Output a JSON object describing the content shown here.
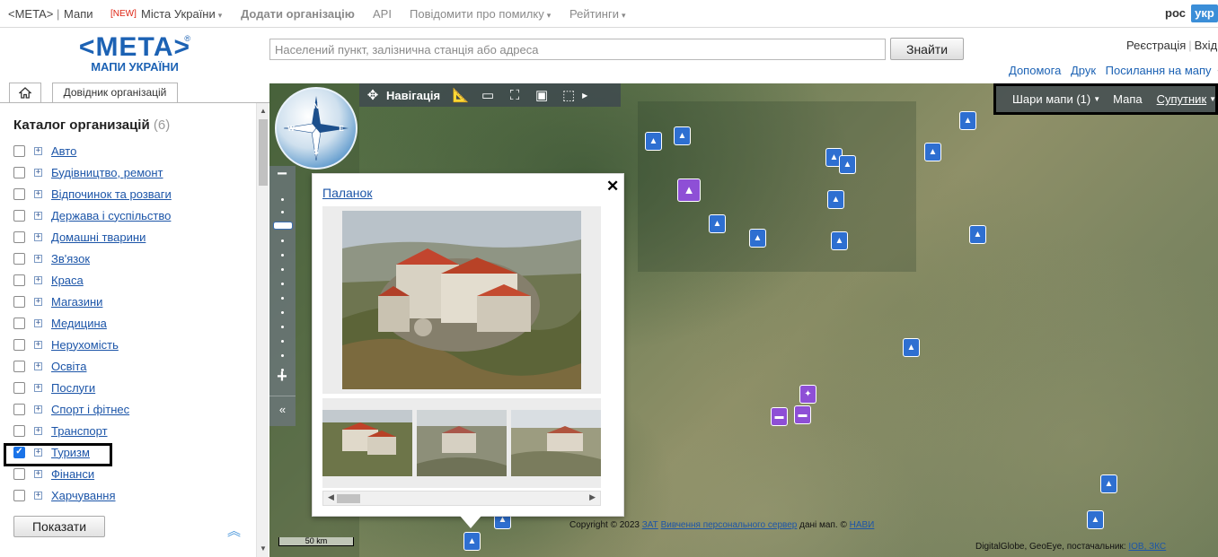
{
  "topnav": {
    "meta": "<META>",
    "sep": "|",
    "maps": "Мапи",
    "new_badge": "[NEW]",
    "cities": "Міста України",
    "add_org": "Додати організацію",
    "api": "API",
    "report_error": "Повідомити про помилку",
    "ratings": "Рейтинги",
    "lang_ros": "рос",
    "lang_ukr": "укр"
  },
  "header": {
    "logo_main": "<МЕТА>",
    "logo_reg": "®",
    "logo_sub": "МАПИ УКРАЇНИ",
    "search_placeholder": "Населений пункт, залізнична станція або адреса",
    "search_value": "",
    "find_button": "Знайти",
    "register": "Реєстрація",
    "login": "Вхід",
    "help": "Допомога",
    "print": "Друк",
    "map_link": "Посилання на мапу"
  },
  "tabs": {
    "directory": "Довідник організацій"
  },
  "sidebar": {
    "title": "Каталог организацій",
    "count": "(6)",
    "categories": [
      {
        "label": "Авто",
        "checked": false
      },
      {
        "label": "Будівництво, ремонт",
        "checked": false
      },
      {
        "label": "Відпочинок та розваги",
        "checked": false
      },
      {
        "label": "Держава і суспільство",
        "checked": false
      },
      {
        "label": "Домашні тварини",
        "checked": false
      },
      {
        "label": "Зв'язок",
        "checked": false
      },
      {
        "label": "Краса",
        "checked": false
      },
      {
        "label": "Магазини",
        "checked": false
      },
      {
        "label": "Медицина",
        "checked": false
      },
      {
        "label": "Нерухомість",
        "checked": false
      },
      {
        "label": "Освіта",
        "checked": false
      },
      {
        "label": "Послуги",
        "checked": false
      },
      {
        "label": "Спорт і фітнес",
        "checked": false
      },
      {
        "label": "Транспорт",
        "checked": false
      },
      {
        "label": "Туризм",
        "checked": true
      },
      {
        "label": "Фінанси",
        "checked": false
      },
      {
        "label": "Харчування",
        "checked": false
      }
    ],
    "show_button": "Показати"
  },
  "map": {
    "toolbar": {
      "navigation": "Навігація"
    },
    "layers": {
      "layers_label": "Шари мапи (1)",
      "map_label": "Мапа",
      "satellite_label": "Супутник"
    },
    "scale": "50 km",
    "copyright_prefix": "Copyright © 2023",
    "copyright_links": [
      "ЗАТ",
      "Вивчення персонального сервер"
    ],
    "copyright_data": "дані мап. ©",
    "copyright_link2": "НАВИ",
    "copyright2_text": "DigitalGlobe, GeoEye, постачальник:",
    "copyright2_link": "ІОВ, ЗКС"
  },
  "popup": {
    "title": "Паланок",
    "close": "✕"
  },
  "colors": {
    "accent": "#1c62b4",
    "marker_blue": "#2e6fd1",
    "marker_purple": "#8e4fd6",
    "lang_active": "#3b8ed8"
  }
}
